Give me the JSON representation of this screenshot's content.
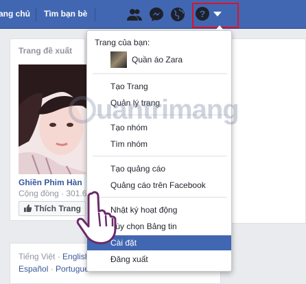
{
  "topbar": {
    "nav": [
      "ang chủ",
      "Tìm bạn bè"
    ],
    "icons": [
      "friends-icon",
      "messenger-icon",
      "globe-icon",
      "help-icon",
      "caret-down-icon"
    ],
    "help_glyph": "?"
  },
  "left_card": {
    "title": "Trang đề xuất",
    "page_name": "Ghiền Phim Hàn",
    "page_sub": "Cộng đồng · 301.6",
    "like_label": "Thích Trang"
  },
  "language": {
    "line1_current": "Tiếng Việt · ",
    "line1_link": "English",
    "line2_a": "Español",
    "line2_sep": " · ",
    "line2_b": "Portugue"
  },
  "menu": {
    "header": "Trang của bạn:",
    "page": "Quần áo Zara",
    "items": [
      "Tạo Trang",
      "Quản lý trang",
      "Tạo nhóm",
      "Tìm nhóm",
      "Tạo quảng cáo",
      "Quảng cáo trên Facebook",
      "Nhật ký hoạt động",
      "Tùy chọn Bảng tin",
      "Cài đặt",
      "Đăng xuất"
    ],
    "active_item": "Cài đặt"
  },
  "watermark": "uantrimang",
  "colors": {
    "brand": "#4267b2",
    "highlight": "#e0112b"
  }
}
